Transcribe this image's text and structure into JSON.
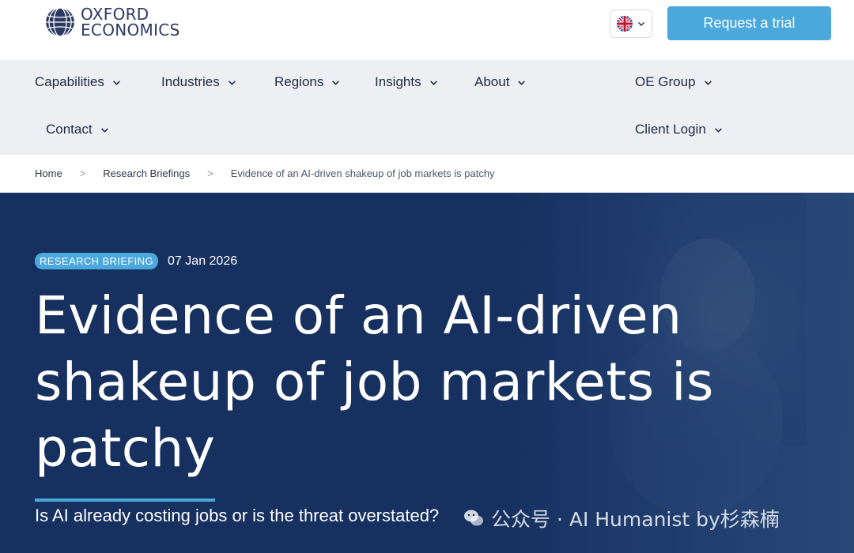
{
  "header": {
    "logo_line1": "OXFORD",
    "logo_line2": "ECONOMICS",
    "language_icon": "uk-flag-icon",
    "cta_label": "Request a trial"
  },
  "nav": {
    "items": [
      {
        "label": "Capabilities"
      },
      {
        "label": "Industries"
      },
      {
        "label": "Regions"
      },
      {
        "label": "Insights"
      },
      {
        "label": "About"
      },
      {
        "label": "OE Group"
      },
      {
        "label": "Contact"
      },
      {
        "label": "Client Login"
      }
    ]
  },
  "breadcrumb": {
    "items": [
      "Home",
      "Research Briefings",
      "Evidence of an AI-driven shakeup of job markets is patchy"
    ],
    "separator": ">"
  },
  "hero": {
    "badge": "RESEARCH BRIEFING",
    "date": "07 Jan 2026",
    "title": "Evidence of an AI-driven shakeup of job markets is patchy",
    "subtitle": "Is AI already costing jobs or is the threat overstated?"
  },
  "watermark": {
    "text": "公众号 · AI Humanist by杉森楠"
  },
  "colors": {
    "brand_navy": "#16305f",
    "accent_blue": "#4aa8dc",
    "nav_bg": "#edeff3"
  }
}
